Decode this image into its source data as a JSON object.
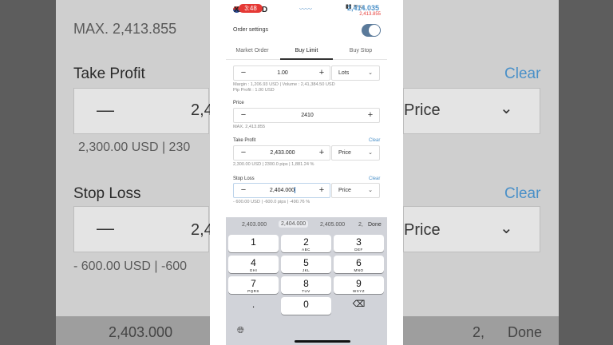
{
  "background": {
    "max_text": "MAX. 2,413.855",
    "take_profit_label": "Take Profit",
    "clear_1": "Clear",
    "value_tp": "2,4",
    "price_label_1": "Price",
    "info_tp": "2,300.00 USD | 230",
    "stop_loss_label": "Stop Loss",
    "clear_2": "Clear",
    "value_sl": "2,4",
    "price_label_2": "Price",
    "info_sl": "- 600.00 USD | -600",
    "kbd_left": "2,403.000",
    "kbd_mid": "2,",
    "kbd_done": "Done"
  },
  "status": {
    "time": "3:48",
    "symbol": "XAUUSD",
    "price": "2,414.035",
    "price_sub": "2,413.855"
  },
  "order_settings": {
    "label": "Order settings",
    "enabled": true
  },
  "tabs": [
    {
      "label": "Market Order",
      "active": false
    },
    {
      "label": "Buy Limit",
      "active": true
    },
    {
      "label": "Buy Stop",
      "active": false
    }
  ],
  "volume": {
    "value": "1.00",
    "unit": "Lots",
    "info_line1": "Margin : 1,206.93 USD  |  Volume : 2,41,384.50 USD",
    "info_line2": "Pip Profit : 1.00 USD"
  },
  "price": {
    "label": "Price",
    "value": "2410",
    "max": "MAX. 2,413.855"
  },
  "take_profit": {
    "label": "Take Profit",
    "clear": "Clear",
    "value": "2,433.000",
    "mode": "Price",
    "info": "2,300.00 USD | 2300.0 pips | 1,881.24 %"
  },
  "stop_loss": {
    "label": "Stop Loss",
    "clear": "Clear",
    "value": "2,404.000",
    "mode": "Price",
    "info": "- 600.00 USD | -600.0 pips | -490.76 %"
  },
  "keyboard": {
    "suggestions": [
      "2,403.000",
      "2,404.000",
      "2,405.000",
      "2,"
    ],
    "done": "Done",
    "keys": [
      {
        "num": "1",
        "letters": ""
      },
      {
        "num": "2",
        "letters": "ABC"
      },
      {
        "num": "3",
        "letters": "DEF"
      },
      {
        "num": "4",
        "letters": "GHI"
      },
      {
        "num": "5",
        "letters": "JKL"
      },
      {
        "num": "6",
        "letters": "MNO"
      },
      {
        "num": "7",
        "letters": "PQRS"
      },
      {
        "num": "8",
        "letters": "TUV"
      },
      {
        "num": "9",
        "letters": "WXYZ"
      },
      {
        "num": ".",
        "letters": ""
      },
      {
        "num": "0",
        "letters": ""
      }
    ]
  }
}
